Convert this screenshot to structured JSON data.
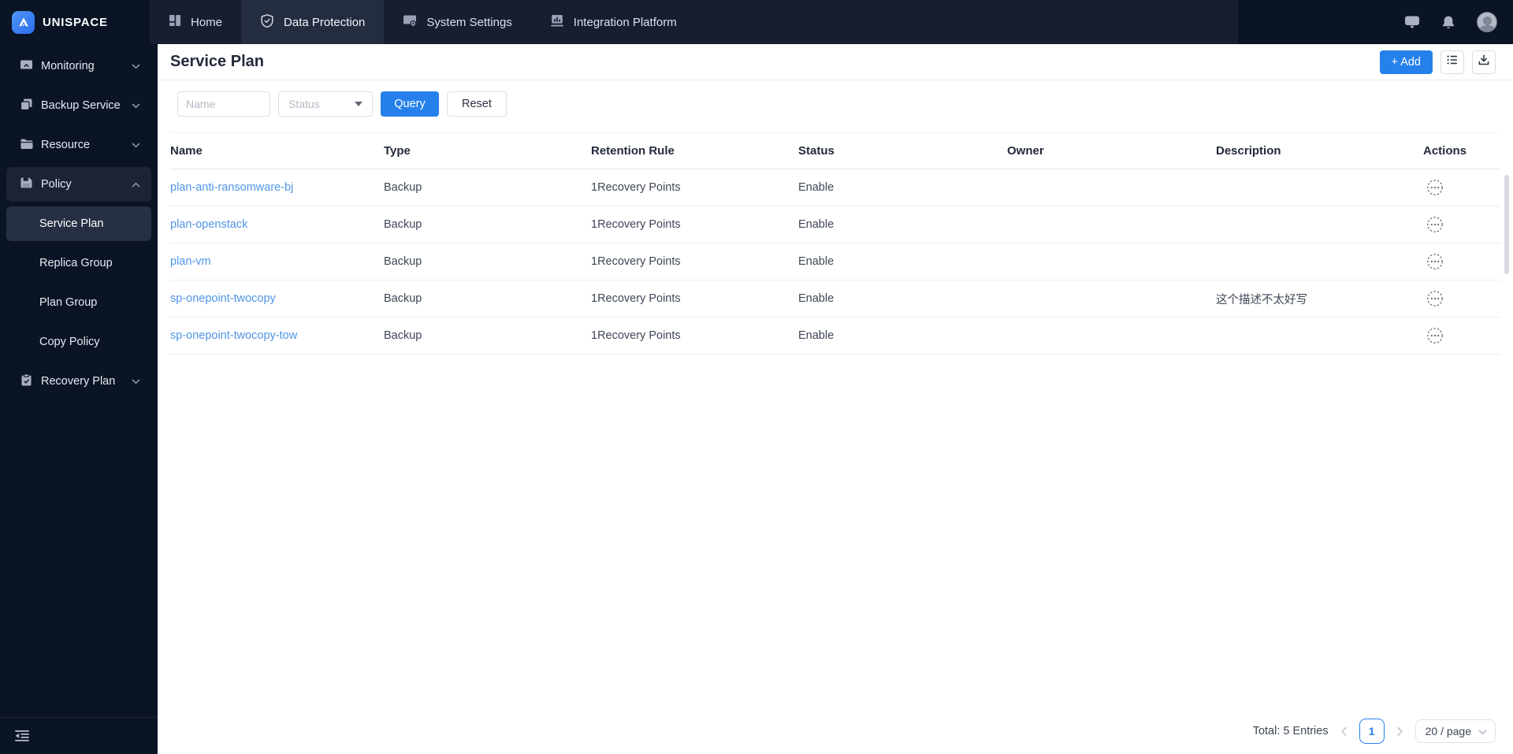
{
  "brand": {
    "name": "UNISPACE"
  },
  "topbar": {
    "tabs": [
      {
        "label": "Home"
      },
      {
        "label": "Data Protection"
      },
      {
        "label": "System Settings"
      },
      {
        "label": "Integration Platform"
      }
    ]
  },
  "sidebar": {
    "items": [
      {
        "label": "Monitoring"
      },
      {
        "label": "Backup Service"
      },
      {
        "label": "Resource"
      },
      {
        "label": "Policy"
      },
      {
        "label": "Recovery Plan"
      }
    ],
    "policy_children": [
      {
        "label": "Service Plan"
      },
      {
        "label": "Replica Group"
      },
      {
        "label": "Plan Group"
      },
      {
        "label": "Copy Policy"
      }
    ]
  },
  "page": {
    "title": "Service Plan"
  },
  "toolbar": {
    "add_label": "+ Add"
  },
  "filters": {
    "name_placeholder": "Name",
    "status_value": "Status",
    "query_label": "Query",
    "reset_label": "Reset"
  },
  "table": {
    "columns": [
      "Name",
      "Type",
      "Retention Rule",
      "Status",
      "Owner",
      "Description",
      "Actions"
    ],
    "rows": [
      {
        "name": "plan-anti-ransomware-bj",
        "type": "Backup",
        "retention": "1Recovery Points",
        "status": "Enable",
        "owner": "",
        "description": ""
      },
      {
        "name": "plan-openstack",
        "type": "Backup",
        "retention": "1Recovery Points",
        "status": "Enable",
        "owner": "",
        "description": ""
      },
      {
        "name": "plan-vm",
        "type": "Backup",
        "retention": "1Recovery Points",
        "status": "Enable",
        "owner": "",
        "description": ""
      },
      {
        "name": "sp-onepoint-twocopy",
        "type": "Backup",
        "retention": "1Recovery Points",
        "status": "Enable",
        "owner": "",
        "description": "这个描述不太好写"
      },
      {
        "name": "sp-onepoint-twocopy-tow",
        "type": "Backup",
        "retention": "1Recovery Points",
        "status": "Enable",
        "owner": "",
        "description": ""
      }
    ]
  },
  "pagination": {
    "total_label": "Total: 5 Entries",
    "current_page": "1",
    "page_size_label": "20 / page"
  },
  "colors": {
    "accent_blue": "#2680eb",
    "link_blue": "#4f94e5",
    "topbar_bg": "#0b1424",
    "tabstrip_bg": "#161e30",
    "active_tab_bg": "#242c3f",
    "sidebar_active_bg": "#272f45",
    "policy_open_bg": "#1b2335"
  }
}
